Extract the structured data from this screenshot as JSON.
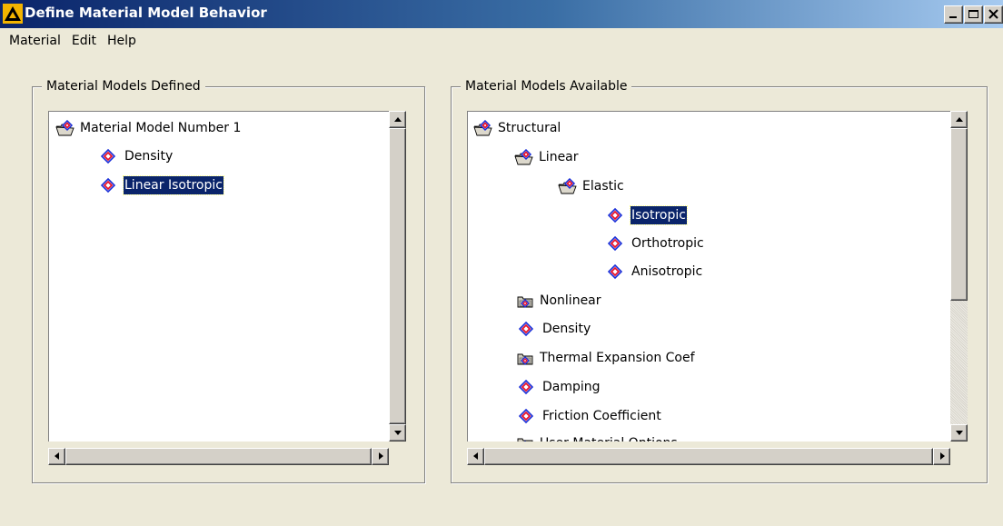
{
  "window": {
    "title": "Define Material Model Behavior",
    "controls": {
      "minimize_icon": "minimize-icon",
      "maximize_icon": "maximize-icon",
      "close_icon": "close-icon"
    }
  },
  "menu": [
    "Material",
    "Edit",
    "Help"
  ],
  "defined_panel": {
    "legend": "Material Models Defined",
    "nodes": [
      {
        "label": "Material Model Number 1",
        "icon": "open-folder-icon",
        "selected": false
      },
      {
        "label": "Density",
        "icon": "material-property-icon",
        "selected": false
      },
      {
        "label": "Linear Isotropic",
        "icon": "material-property-icon",
        "selected": true
      }
    ]
  },
  "available_panel": {
    "legend": "Material Models Available",
    "nodes": [
      {
        "label": "Structural",
        "icon": "open-folder-icon",
        "selected": false
      },
      {
        "label": "Linear",
        "icon": "open-folder-icon",
        "selected": false
      },
      {
        "label": "Elastic",
        "icon": "open-folder-icon",
        "selected": false
      },
      {
        "label": "Isotropic",
        "icon": "material-property-icon",
        "selected": true
      },
      {
        "label": "Orthotropic",
        "icon": "material-property-icon",
        "selected": false
      },
      {
        "label": "Anisotropic",
        "icon": "material-property-icon",
        "selected": false
      },
      {
        "label": "Nonlinear",
        "icon": "closed-folder-icon",
        "selected": false
      },
      {
        "label": "Density",
        "icon": "material-property-icon",
        "selected": false
      },
      {
        "label": "Thermal Expansion Coef",
        "icon": "closed-folder-icon",
        "selected": false
      },
      {
        "label": "Damping",
        "icon": "material-property-icon",
        "selected": false
      },
      {
        "label": "Friction Coefficient",
        "icon": "material-property-icon",
        "selected": false
      },
      {
        "label": "User Material Options",
        "icon": "closed-folder-icon",
        "selected": false
      }
    ]
  },
  "colors": {
    "titlebar_start": "#0a246a",
    "titlebar_end": "#a6caf0",
    "selection": "#0a246a",
    "dialog_bg": "#ece9d8",
    "icon_red": "#e8102a",
    "icon_blue": "#1a2fd8"
  }
}
